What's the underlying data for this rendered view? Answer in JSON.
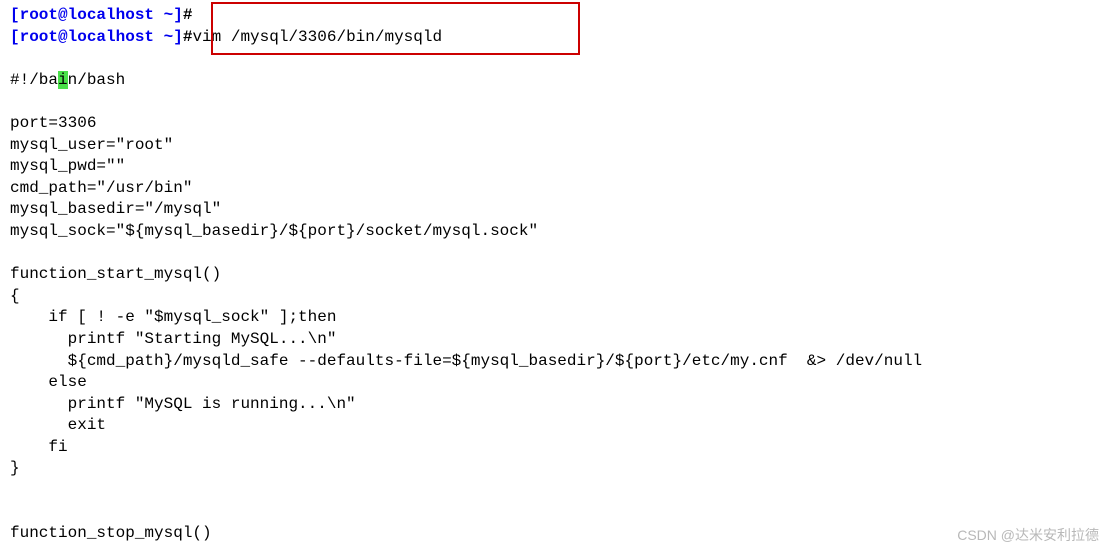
{
  "terminal": {
    "prompt1_truncated": "[root@localhost ~]",
    "prompt1_hash": "#",
    "prompt2": "[root@localhost ~]",
    "prompt2_hash": "#",
    "command": "vim /mysql/3306/bin/mysqld",
    "shebang_pre": "#!/ba",
    "shebang_cursor": "i",
    "shebang_post": "n/bash",
    "script": {
      "l1": "port=3306",
      "l2": "mysql_user=\"root\"",
      "l3": "mysql_pwd=\"\"",
      "l4": "cmd_path=\"/usr/bin\"",
      "l5": "mysql_basedir=\"/mysql\"",
      "l6": "mysql_sock=\"${mysql_basedir}/${port}/socket/mysql.sock\"",
      "l7": "function_start_mysql()",
      "l8": "{",
      "l9": "    if [ ! -e \"$mysql_sock\" ];then",
      "l10": "      printf \"Starting MySQL...\\n\"",
      "l11": "      ${cmd_path}/mysqld_safe --defaults-file=${mysql_basedir}/${port}/etc/my.cnf  &> /dev/null",
      "l12": "    else",
      "l13": "      printf \"MySQL is running...\\n\"",
      "l14": "      exit",
      "l15": "    fi",
      "l16": "}",
      "l17": "function_stop_mysql()"
    }
  },
  "watermark": "CSDN @达米安利拉德"
}
